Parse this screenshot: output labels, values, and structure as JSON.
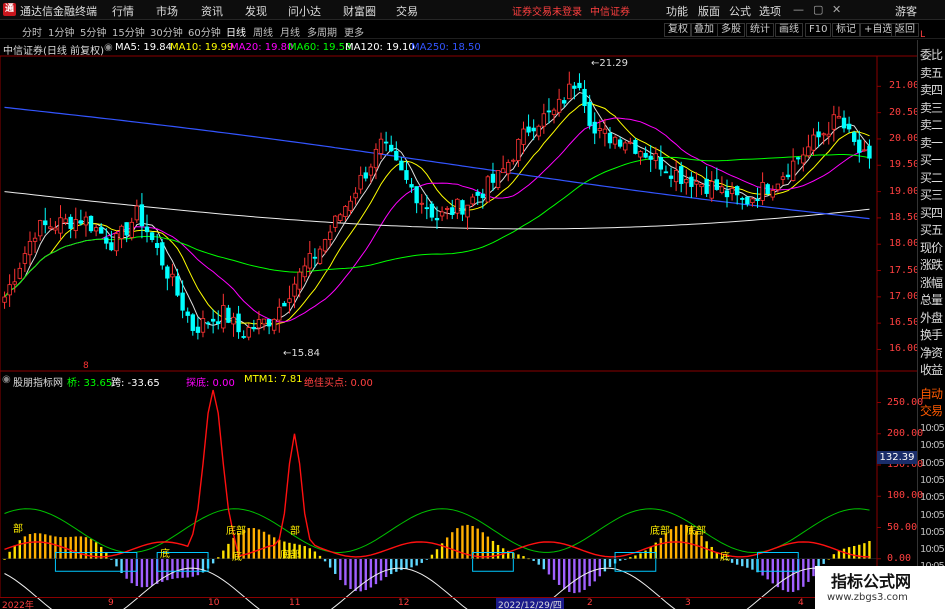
{
  "app": {
    "logo_glyph": "通",
    "title": "通达信金融终端",
    "menus": [
      "行情",
      "市场",
      "资讯",
      "发现",
      "问小达",
      "财富圈",
      "交易"
    ],
    "login_status": "证券交易未登录",
    "broker": "中信证券",
    "right_menus": [
      "功能",
      "版面",
      "公式",
      "选项"
    ],
    "guest": "游客",
    "window_buttons": [
      "—",
      "▢",
      "✕"
    ]
  },
  "toolbar": {
    "periods": [
      "分时",
      "1分钟",
      "5分钟",
      "15分钟",
      "30分钟",
      "60分钟",
      "日线",
      "周线",
      "月线",
      "多周期",
      "更多"
    ],
    "active_period": "日线",
    "right_buttons": [
      "复权",
      "叠加",
      "多股",
      "统计",
      "画线",
      "F10",
      "标记",
      "+自选",
      "返回"
    ]
  },
  "legend": {
    "stock_name": "中信证券(日线 前复权)",
    "ma": [
      {
        "label": "MA5: 19.84",
        "color": "#ffffff"
      },
      {
        "label": "MA10: 19.99",
        "color": "#ffff00"
      },
      {
        "label": "MA20: 19.80",
        "color": "#ff00ff"
      },
      {
        "label": "MA60: 19.58",
        "color": "#00ff00"
      },
      {
        "label": "MA120: 19.10",
        "color": "#ffffff"
      },
      {
        "label": "MA250: 18.50",
        "color": "#3355ff"
      }
    ]
  },
  "price_axis": [
    "21.00",
    "20.50",
    "20.00",
    "19.50",
    "19.00",
    "18.50",
    "18.00",
    "17.50",
    "17.00",
    "16.50",
    "16.00"
  ],
  "max_label": "21.29",
  "min_label": "15.84",
  "corner": {
    "letter": "L",
    "count": "300"
  },
  "right_panel": [
    "委比",
    "卖五",
    "卖四",
    "卖三",
    "卖二",
    "卖一",
    "买一",
    "买二",
    "买三",
    "买四",
    "买五",
    "现价",
    "涨跌",
    "涨幅",
    "总量",
    "外盘",
    "换手",
    "净资",
    "收益",
    "自动",
    "交易",
    "10:05",
    "10:05",
    "10:05",
    "10:05",
    "10:05",
    "10:05",
    "10:05",
    "10:05",
    "10:05",
    "10:05",
    "10:05"
  ],
  "indicator": {
    "name": "股朋指标网",
    "items": [
      {
        "label": "桥: 33.65",
        "color": "#00ff00"
      },
      {
        "label": "跨: -33.65",
        "color": "#ffffff"
      },
      {
        "label": "探底: 0.00",
        "color": "#ff00ff"
      },
      {
        "label": "MTM1: 7.81",
        "color": "#ffff00"
      },
      {
        "label": "绝佳买点: 0.00",
        "color": "#ff4040"
      }
    ],
    "axis": [
      "250.00",
      "200.00",
      "150.00",
      "100.00",
      "50.00",
      "0.00"
    ],
    "marker_value": "132.39",
    "tags": [
      "部",
      "底",
      "底部",
      "底",
      "部",
      "底部",
      "底部",
      "底部",
      "底"
    ],
    "marker_8": "8"
  },
  "x_axis": {
    "labels": [
      "2022年",
      "9",
      "10",
      "11",
      "12",
      "2022/12/29/四",
      "2",
      "3",
      "4"
    ],
    "highlight": "2022/12/29/四"
  },
  "watermark": {
    "title": "指标公式网",
    "url": "www.zbgs3.com"
  },
  "colors": {
    "up": "#ff3333",
    "down": "#00ffff",
    "bg": "#000000",
    "axis": "#ff4040"
  }
}
